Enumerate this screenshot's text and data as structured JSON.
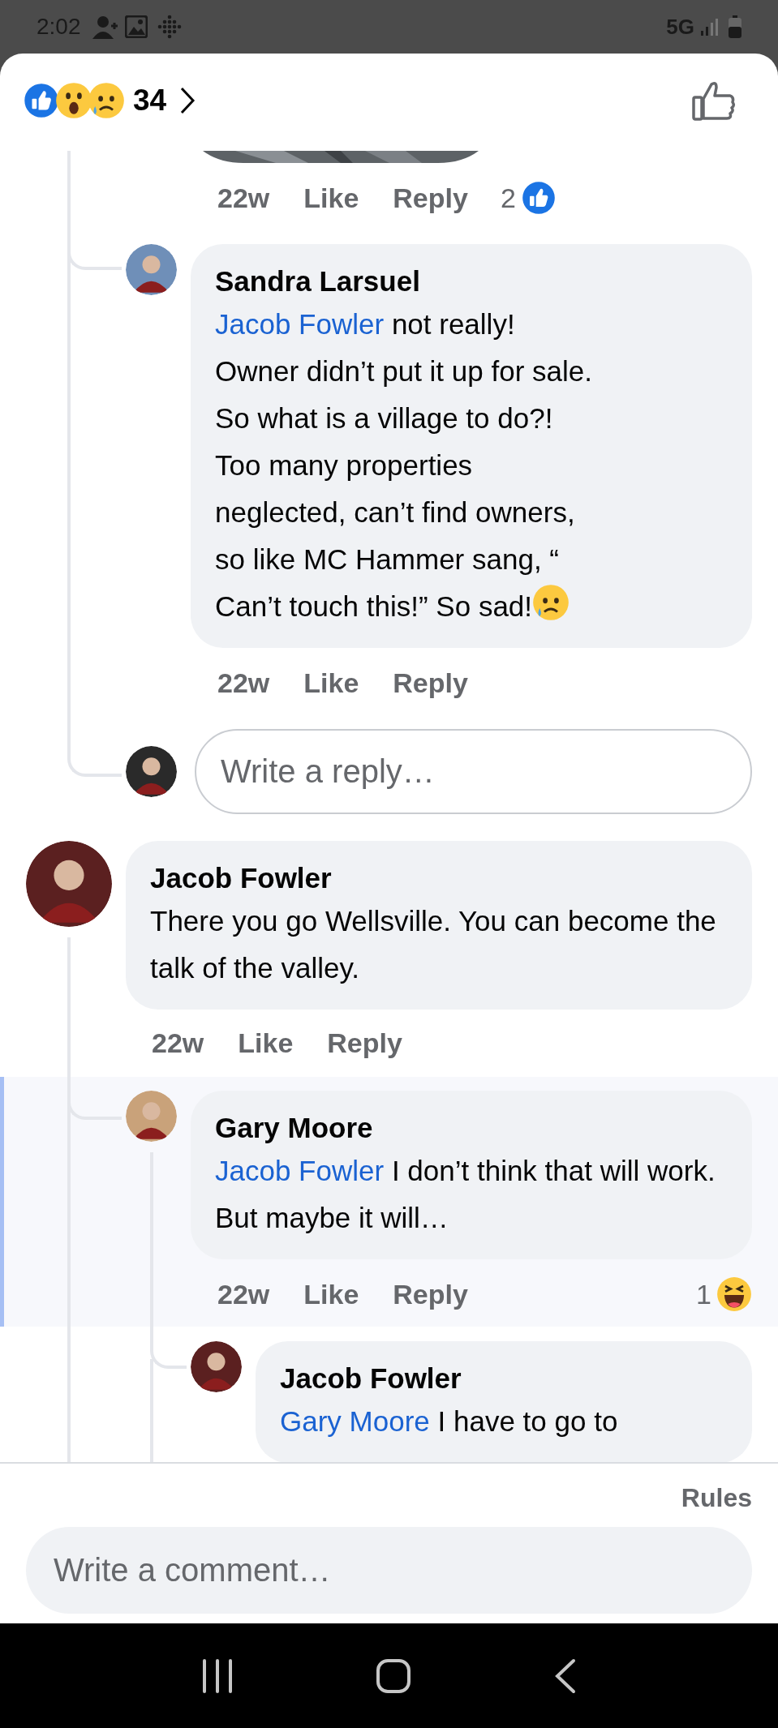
{
  "status_bar": {
    "time": "2:02",
    "network": "5G"
  },
  "header": {
    "reactions": [
      {
        "kind": "like"
      },
      {
        "kind": "wow"
      },
      {
        "kind": "sad"
      }
    ],
    "reaction_count": "34"
  },
  "thread": {
    "previous_comment": {
      "time": "22w",
      "like": "Like",
      "reply": "Reply",
      "reaction": {
        "kind": "like",
        "count": "2"
      }
    },
    "comments": [
      {
        "author": "Sandra Larsuel",
        "mention": "Jacob Fowler",
        "text": "not really!\nOwner didn’t put it up for sale.\nSo what is a village to do?!\nToo many properties\nneglected, can’t find owners,\nso like MC Hammer sang, “\nCan’t touch this!” So sad!",
        "trailing_emoji": {
          "kind": "sad"
        },
        "time": "22w",
        "like": "Like",
        "reply": "Reply",
        "highlighted": false
      },
      {
        "kind": "reply_field",
        "placeholder": "Write a reply…"
      },
      {
        "author": "Jacob Fowler",
        "text": "There you go Wellsville. You can become the talk of the valley.",
        "time": "22w",
        "like": "Like",
        "reply": "Reply",
        "highlighted": false
      },
      {
        "author": "Gary Moore",
        "mention": "Jacob Fowler",
        "text": "I don’t think that will work. But maybe it will…",
        "time": "22w",
        "like": "Like",
        "reply": "Reply",
        "reaction": {
          "kind": "haha",
          "count": "1"
        },
        "highlighted": true
      },
      {
        "author": "Jacob Fowler",
        "mention": "Gary Moore",
        "text": "I have to go to",
        "highlighted": false
      }
    ]
  },
  "footer": {
    "rules": "Rules",
    "placeholder": "Write a comment…"
  }
}
